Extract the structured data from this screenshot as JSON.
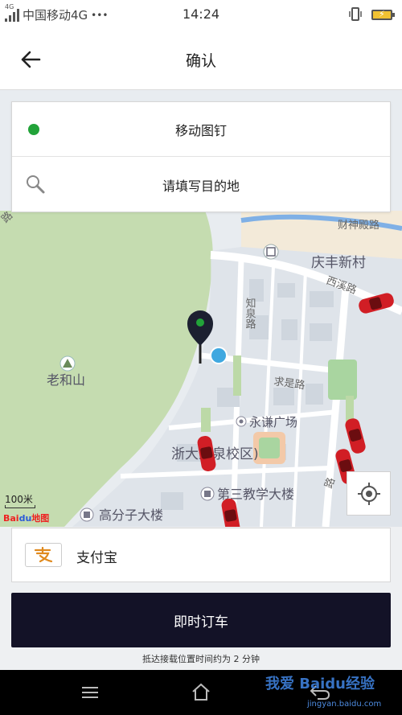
{
  "status_bar": {
    "network_small": "4G",
    "carrier": "中国移动4G",
    "dots": "•••",
    "time": "14:24"
  },
  "header": {
    "title": "确认"
  },
  "location": {
    "pickup_label": "移动图钉",
    "destination_placeholder": "请填写目的地"
  },
  "map": {
    "labels": {
      "road_top": "路",
      "caishen": "财神殿路",
      "qingfeng": "庆丰新村",
      "xixi": "西溪路",
      "zhiquan": "知泉路",
      "laoheshan": "老和山",
      "qiushi": "求是路",
      "yongqian": "永谦广场",
      "zheda": "浙大玉泉校区)",
      "disan": "第三教学大楼",
      "gaofenzi": "高分子大楼",
      "road_right": "路"
    },
    "scale_label": "100米",
    "logo_text": "Bai du 地图"
  },
  "payment": {
    "method": "支付宝"
  },
  "actions": {
    "book_now": "即时订车",
    "eta_text": "抵达接载位置时间约为 2 分钟"
  },
  "watermark": {
    "text": "我爱 Baidu经验",
    "sub": "jingyan.baidu.com"
  },
  "colors": {
    "accent_dark": "#131227",
    "pickup_green": "#22a339",
    "car_red": "#d11e25",
    "park_green": "#c5dcb0"
  }
}
